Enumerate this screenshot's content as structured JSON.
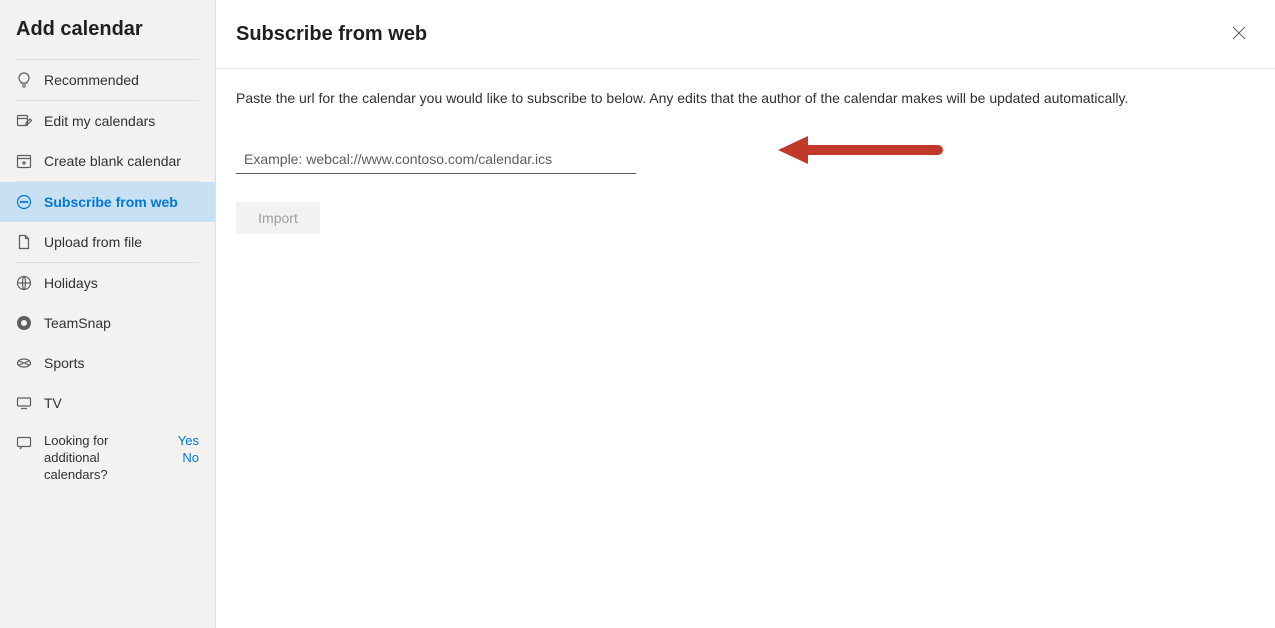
{
  "sidebar": {
    "title": "Add calendar",
    "group1": [
      {
        "label": "Recommended"
      }
    ],
    "group2": [
      {
        "label": "Edit my calendars"
      },
      {
        "label": "Create blank calendar"
      }
    ],
    "group3": [
      {
        "label": "Subscribe from web"
      },
      {
        "label": "Upload from file"
      }
    ],
    "group4": [
      {
        "label": "Holidays"
      },
      {
        "label": "TeamSnap"
      },
      {
        "label": "Sports"
      },
      {
        "label": "TV"
      }
    ],
    "feedback": {
      "text": "Looking for additional calendars?",
      "yes": "Yes",
      "no": "No"
    }
  },
  "main": {
    "title": "Subscribe from web",
    "instruction": "Paste the url for the calendar you would like to subscribe to below. Any edits that the author of the calendar makes will be updated automatically.",
    "input_placeholder": "Example: webcal://www.contoso.com/calendar.ics",
    "import_label": "Import"
  }
}
